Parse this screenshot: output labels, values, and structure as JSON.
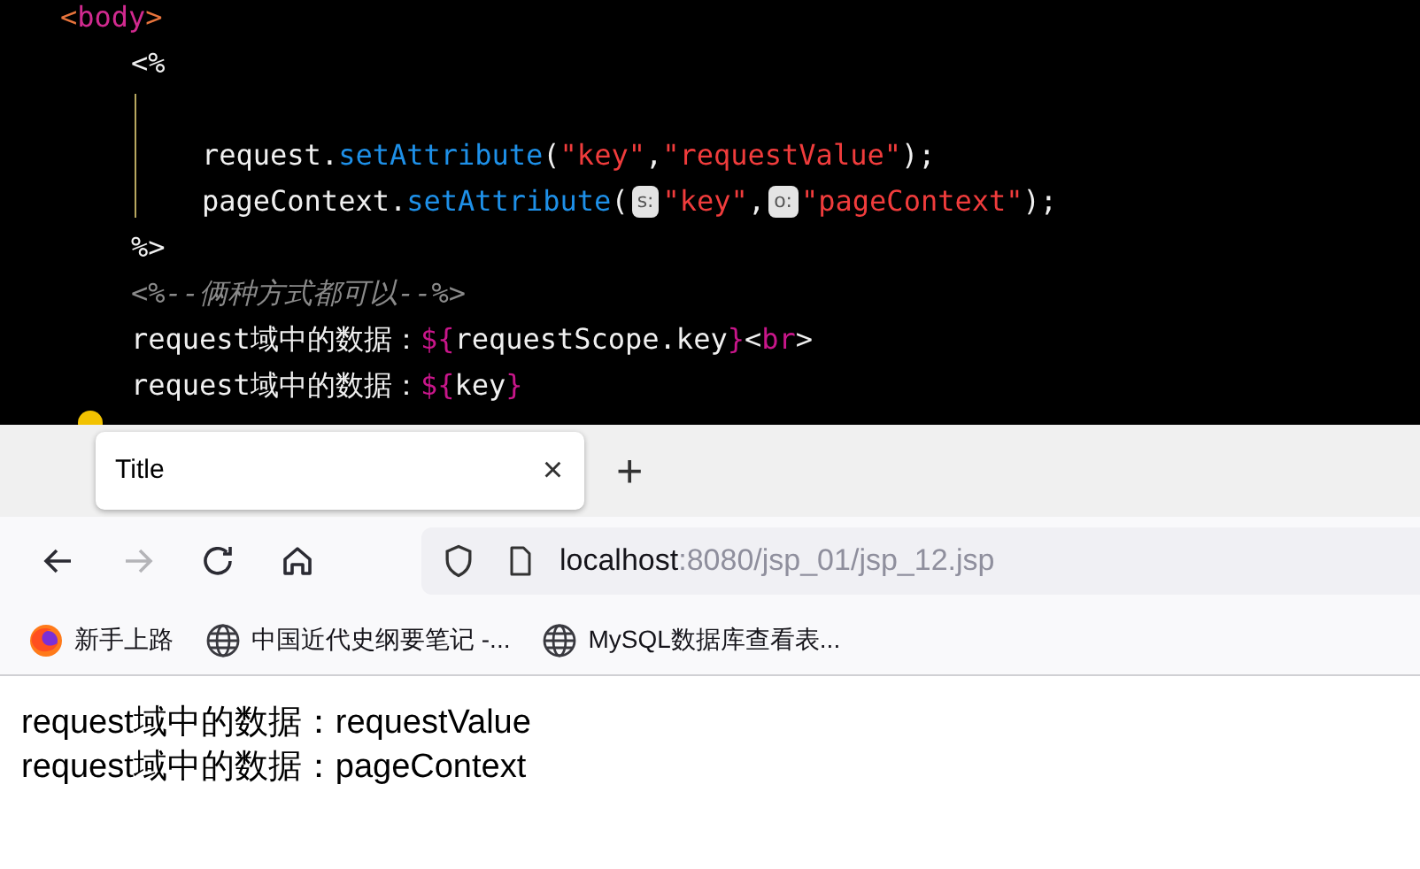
{
  "editor": {
    "lines": [
      {
        "tokens": [
          {
            "kind": "bracket",
            "text": "<"
          },
          {
            "kind": "tag",
            "text": "body"
          },
          {
            "kind": "bracket",
            "text": ">"
          }
        ],
        "children": [
          {
            "tokens": [
              {
                "kind": "plain",
                "text": "<%"
              }
            ],
            "children": [
              {
                "tokens": [
                  {
                    "kind": "plain",
                    "text": "request."
                  },
                  {
                    "kind": "method",
                    "text": "setAttribute"
                  },
                  {
                    "kind": "plain",
                    "text": "("
                  },
                  {
                    "kind": "string",
                    "text": "\"key\""
                  },
                  {
                    "kind": "plain",
                    "text": ","
                  },
                  {
                    "kind": "string",
                    "text": "\"requestValue\""
                  },
                  {
                    "kind": "plain",
                    "text": ");"
                  }
                ]
              },
              {
                "tokens": [
                  {
                    "kind": "plain",
                    "text": "pageContext."
                  },
                  {
                    "kind": "method",
                    "text": "setAttribute"
                  },
                  {
                    "kind": "plain",
                    "text": "("
                  },
                  {
                    "kind": "hint",
                    "text": "s:"
                  },
                  {
                    "kind": "string",
                    "text": "\"key\""
                  },
                  {
                    "kind": "plain",
                    "text": ","
                  },
                  {
                    "kind": "hint",
                    "text": "o:"
                  },
                  {
                    "kind": "string",
                    "text": "\"pageContext\""
                  },
                  {
                    "kind": "plain",
                    "text": ");"
                  }
                ]
              }
            ]
          },
          {
            "tokens": [
              {
                "kind": "plain",
                "text": "%>"
              }
            ]
          },
          {
            "tokens": [
              {
                "kind": "comment",
                "text": "<%--俩种方式都可以--%>"
              }
            ]
          },
          {
            "tokens": [
              {
                "kind": "plain",
                "text": "request域中的数据："
              },
              {
                "kind": "el",
                "text": "${"
              },
              {
                "kind": "plain",
                "text": "requestScope.key"
              },
              {
                "kind": "el",
                "text": "}"
              },
              {
                "kind": "plain",
                "text": "<"
              },
              {
                "kind": "el",
                "text": "br"
              },
              {
                "kind": "plain",
                "text": ">"
              }
            ]
          },
          {
            "tokens": [
              {
                "kind": "plain",
                "text": "request域中的数据："
              },
              {
                "kind": "el",
                "text": "${"
              },
              {
                "kind": "plain",
                "text": "key"
              },
              {
                "kind": "el",
                "text": "}"
              }
            ]
          }
        ]
      }
    ]
  },
  "browser": {
    "tabs": [
      {
        "label": "Title",
        "selected": true,
        "close": "×"
      }
    ],
    "new_tab": "+",
    "nav_buttons": [
      {
        "kind": "back",
        "disabled": false
      },
      {
        "kind": "forward",
        "disabled": true
      },
      {
        "kind": "reload",
        "disabled": false
      },
      {
        "kind": "home",
        "disabled": false
      }
    ],
    "address": {
      "host": "localhost",
      "rest": ":8080/jsp_01/jsp_12.jsp"
    },
    "bookmarks": [
      {
        "kind": "firefox",
        "label": "新手上路"
      },
      {
        "kind": "globe",
        "label": "中国近代史纲要笔记 -..."
      },
      {
        "kind": "globe",
        "label": "MySQL数据库查看表..."
      }
    ],
    "content": [
      "request域中的数据：requestValue",
      "request域中的数据：pageContext"
    ]
  }
}
